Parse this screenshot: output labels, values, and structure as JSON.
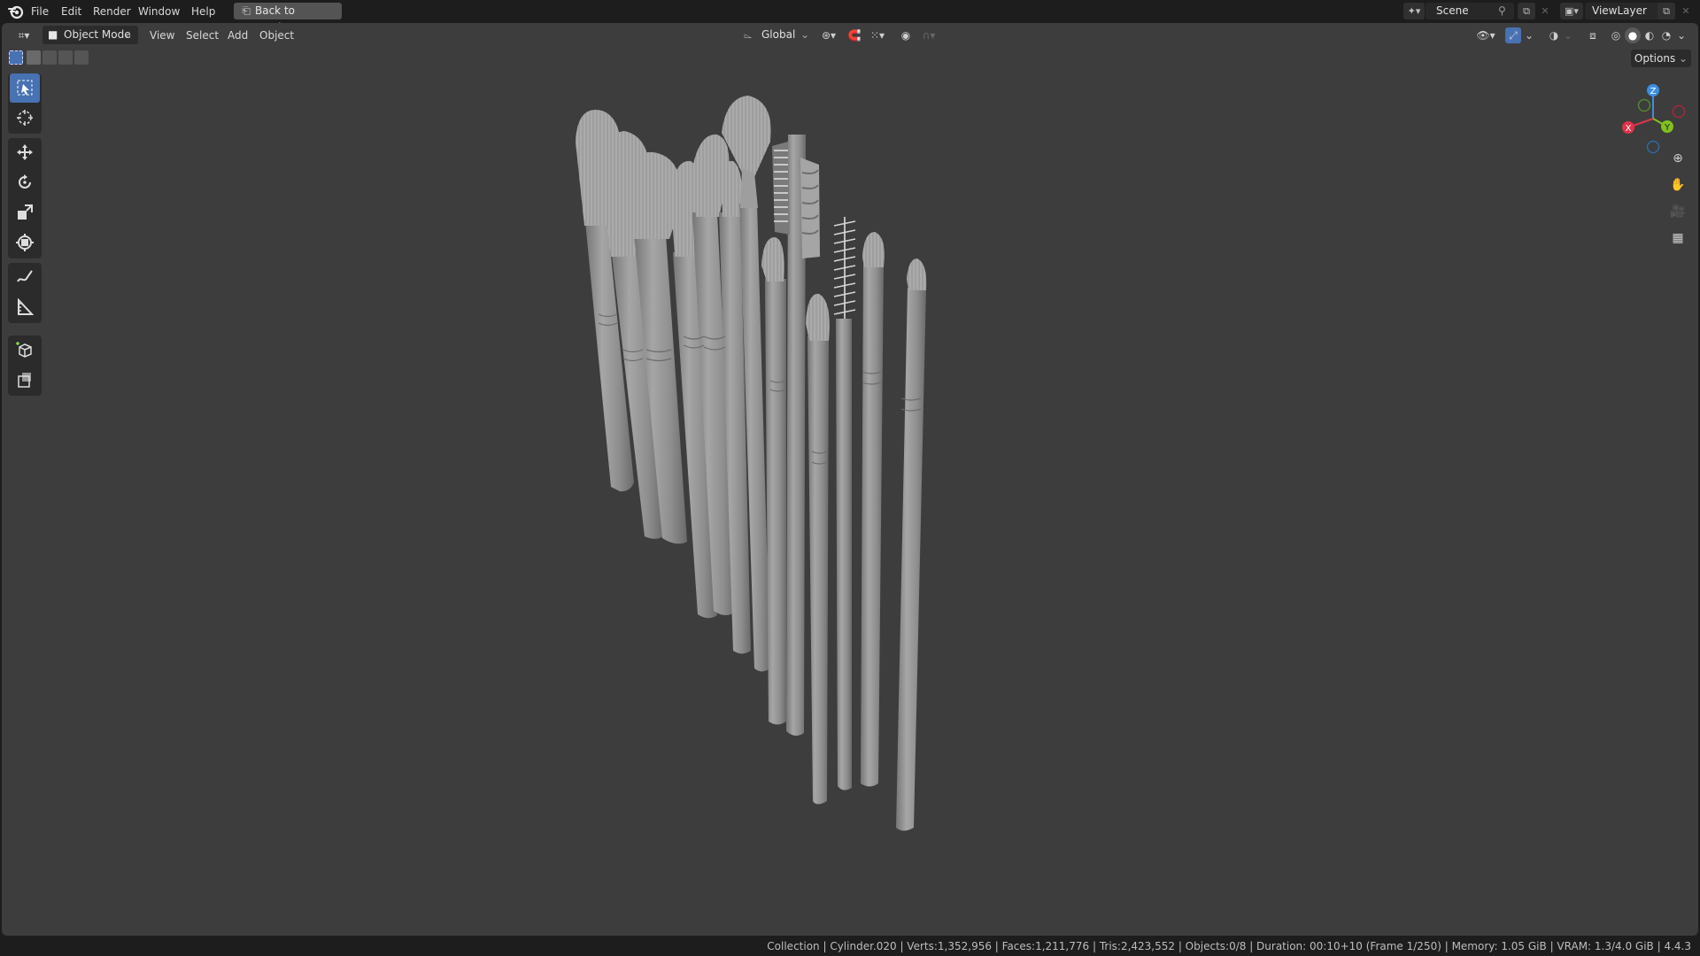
{
  "menu": {
    "file": "File",
    "edit": "Edit",
    "render": "Render",
    "window": "Window",
    "help": "Help",
    "back_to_previous": "Back to Previous"
  },
  "scene": {
    "name": "Scene"
  },
  "view_layer": {
    "name": "ViewLayer"
  },
  "viewport_header": {
    "mode": "Object Mode",
    "view": "View",
    "select": "Select",
    "add": "Add",
    "object": "Object",
    "transform_orientation": "Global",
    "options": "Options"
  },
  "gizmo": {
    "x": "X",
    "y": "Y",
    "z": "Z"
  },
  "toolbar": {
    "tools": [
      "select-box",
      "cursor",
      "move",
      "rotate",
      "scale",
      "transform",
      "annotate",
      "measure",
      "add-cube",
      "add-primitive"
    ],
    "active": "select-box"
  },
  "colors": {
    "accent": "#4772b3",
    "viewport_bg": "#3d3d3d",
    "axis_x": "#e0334a",
    "axis_y": "#80c21f",
    "axis_z": "#3d8ee0"
  },
  "status": {
    "text": "Collection | Cylinder.020 | Verts:1,352,956 | Faces:1,211,776 | Tris:2,423,552 | Objects:0/8 | Duration: 00:10+10 (Frame 1/250) | Memory: 1.05 GiB | VRAM: 1.3/4.0 GiB | 4.4.3"
  }
}
